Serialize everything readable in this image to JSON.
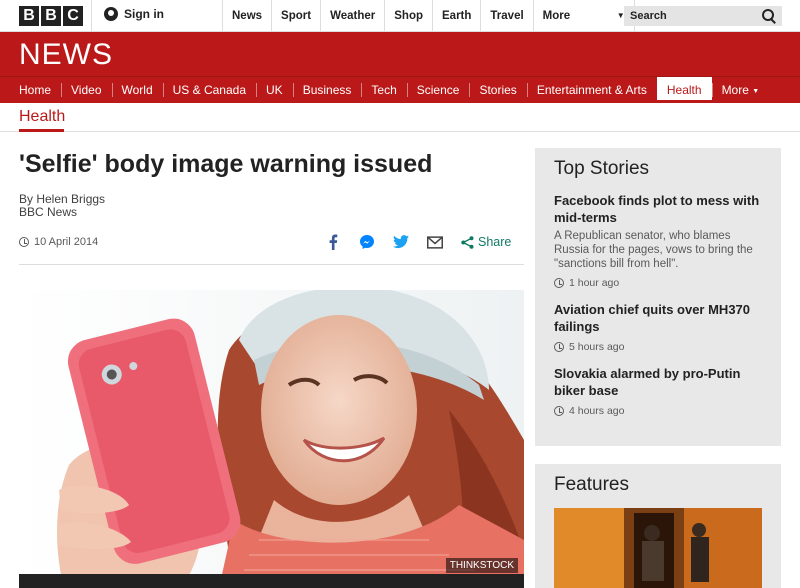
{
  "topbar": {
    "logo_letters": [
      "B",
      "B",
      "C"
    ],
    "signin_label": "Sign in",
    "nav": [
      "News",
      "Sport",
      "Weather",
      "Shop",
      "Earth",
      "Travel"
    ],
    "more_label": "More",
    "search_placeholder": "Search"
  },
  "header": {
    "news_logo": "NEWS"
  },
  "navbar": {
    "items": [
      "Home",
      "Video",
      "World",
      "US & Canada",
      "UK",
      "Business",
      "Tech",
      "Science",
      "Stories",
      "Entertainment & Arts",
      "Health",
      "More"
    ],
    "active_index": 10
  },
  "article": {
    "section": "Health",
    "headline": "'Selfie' body image warning issued",
    "author": "By Helen Briggs",
    "outlet": "BBC News",
    "date": "10 April 2014",
    "share_label": "Share",
    "image_credit": "THINKSTOCK"
  },
  "sidebar": {
    "top_stories_title": "Top Stories",
    "stories": [
      {
        "title": "Facebook finds plot to mess with mid-terms",
        "summary": "A Republican senator, who blames Russia for the pages, vows to bring the \"sanctions bill from hell\".",
        "time": "1 hour ago"
      },
      {
        "title": "Aviation chief quits over MH370 failings",
        "summary": "",
        "time": "5 hours ago"
      },
      {
        "title": "Slovakia alarmed by pro-Putin biker base",
        "summary": "",
        "time": "4 hours ago"
      }
    ],
    "features_title": "Features"
  },
  "colors": {
    "brand_red": "#bb1919",
    "share_green": "#117a65",
    "facebook_blue": "#3b5998",
    "twitter_blue": "#1da1f2",
    "messenger_blue": "#0084ff"
  },
  "icons": [
    "user-icon",
    "search-icon",
    "caret-down-icon",
    "clock-icon",
    "facebook-icon",
    "messenger-icon",
    "twitter-icon",
    "email-icon",
    "share-icon"
  ]
}
